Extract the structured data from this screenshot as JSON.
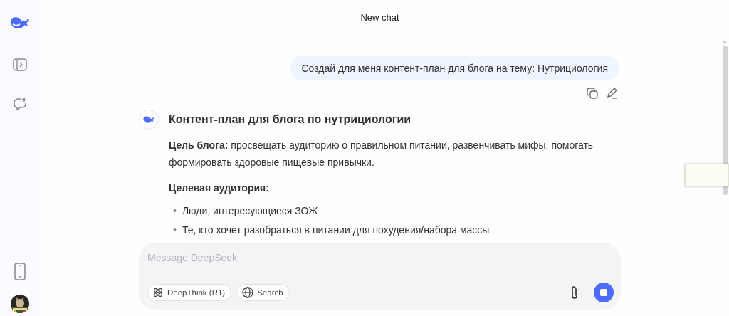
{
  "header": {
    "title": "New chat"
  },
  "messages": [
    {
      "kind": "user",
      "text": "Создай для меня контент-план для блога на тему: Нутрициология"
    },
    {
      "kind": "assistant",
      "title": "Контент-план для блога по нутрициологии",
      "blocks": [
        {
          "kind": "paragraph",
          "text": "**Цель блога:** просвещать аудиторию о правильном питании, развенчивать мифы, помогать формировать здоровые пищевые привычки."
        },
        {
          "kind": "heading",
          "text": "Целевая аудитория:"
        },
        {
          "kind": "list",
          "marker": "•",
          "items": [
            "Люди, интересующиеся ЗОЖ",
            "Те, кто хочет разобраться в питании для похудения/набора массы"
          ]
        }
      ]
    }
  ],
  "composer": {
    "placeholder": "Message DeepSeek",
    "toggles": [
      {
        "kind": "deepthink",
        "label": "DeepThink (R1)",
        "selected": false
      },
      {
        "kind": "search",
        "label": "Search",
        "selected": false
      }
    ]
  }
}
